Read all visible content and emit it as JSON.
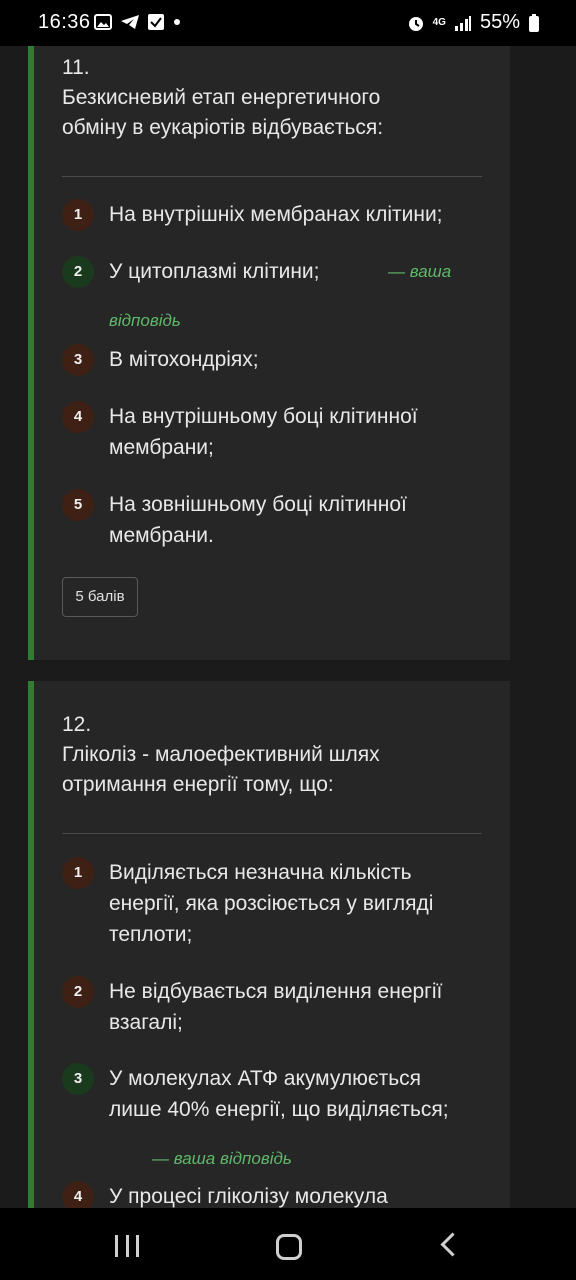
{
  "status": {
    "time": "16:36",
    "left_icons": [
      "image-icon",
      "telegram-icon",
      "checkbox-icon",
      "dot-icon"
    ],
    "right_icons": [
      "alarm-icon",
      "4g-icon",
      "signal-icon"
    ],
    "network": "4G",
    "battery": "55%"
  },
  "questions": [
    {
      "number": "11.",
      "text": "Безкисневий етап енергетичного обміну в еукаріотів відбувається:",
      "options": [
        {
          "num": "1",
          "text": "На внутрішніх мембранах клітини;"
        },
        {
          "num": "2",
          "text": "У цитоплазмі клітини;"
        },
        {
          "num": "3",
          "text": "В мітохондріях;"
        },
        {
          "num": "4",
          "text": "На внутрішньому боці клітинної мембрани;"
        },
        {
          "num": "5",
          "text": "На зовнішньому боці клітинної мембрани."
        }
      ],
      "your_answer_line1": "— ваша",
      "your_answer_line2": "відповідь",
      "points": "5 балів"
    },
    {
      "number": "12.",
      "text": "Гліколіз - малоефективний шлях отримання енергії тому, що:",
      "options": [
        {
          "num": "1",
          "text": "Виділяється незначна кількість енергії, яка розсіюється у вигляді теплоти;"
        },
        {
          "num": "2",
          "text": "Не відбувається виділення енергії взагалі;"
        },
        {
          "num": "3",
          "text": "У молекулах АТФ акумулюється лише 40% енергії, що виділяється;"
        },
        {
          "num": "4",
          "text": "У процесі гліколізу молекула"
        }
      ],
      "your_answer": "— ваша відповідь"
    }
  ],
  "colors": {
    "accent_green": "#2e7d32",
    "answer_green": "#5fb86a",
    "card_bg": "#262626",
    "page_bg": "#1b1b1b"
  }
}
